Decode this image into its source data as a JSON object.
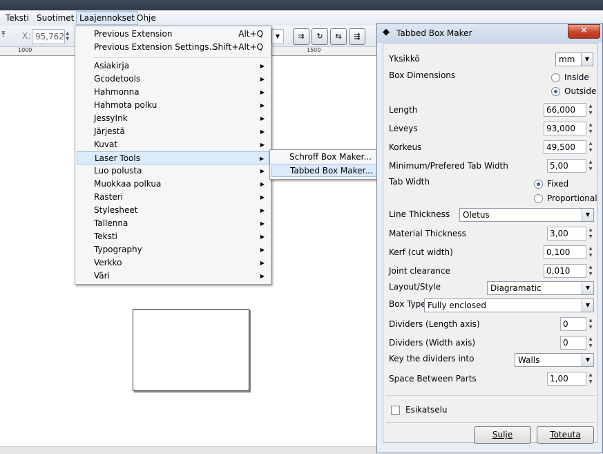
{
  "menubar": {
    "items": [
      "Teksti",
      "Suotimet",
      "Laajennokset",
      "Ohje"
    ],
    "open_item": "Laajennokset"
  },
  "toolbar": {
    "x_label": "X:",
    "x_value": "95,762"
  },
  "ruler": {
    "ticks": [
      "1000",
      "1500"
    ]
  },
  "extensions_menu": {
    "top_items": [
      {
        "label": "Previous Extension",
        "shortcut": "Alt+Q"
      },
      {
        "label": "Previous Extension Settings...",
        "shortcut": "Shift+Alt+Q"
      }
    ],
    "submenus": [
      "Asiakirja",
      "Gcodetools",
      "Hahmonna",
      "Hahmota polku",
      "JessyInk",
      "Järjestä",
      "Kuvat",
      "Laser Tools",
      "Luo polusta",
      "Muokkaa polkua",
      "Rasteri",
      "Stylesheet",
      "Tallenna",
      "Teksti",
      "Typography",
      "Verkko",
      "Väri"
    ],
    "highlighted": "Laser Tools"
  },
  "laser_tools_menu": {
    "items": [
      "Schroff Box Maker...",
      "Tabbed Box Maker..."
    ],
    "highlighted": "Tabbed Box Maker..."
  },
  "dialog": {
    "title": "Tabbed Box Maker",
    "close_symbol": "✕",
    "unit": {
      "label": "Yksikkö",
      "value": "mm"
    },
    "box_dimensions": {
      "label": "Box Dimensions",
      "options": [
        "Inside",
        "Outside"
      ],
      "selected": "Outside"
    },
    "length": {
      "label": "Length",
      "value": "66,000"
    },
    "width": {
      "label": "Leveys",
      "value": "93,000"
    },
    "height": {
      "label": "Korkeus",
      "value": "49,500"
    },
    "tab_width_min": {
      "label": "Minimum/Prefered Tab Width",
      "value": "5,00"
    },
    "tab_width": {
      "label": "Tab Width",
      "options": [
        "Fixed",
        "Proportional"
      ],
      "selected": "Fixed"
    },
    "line_thickness": {
      "label": "Line Thickness",
      "value": "Oletus"
    },
    "material_thickness": {
      "label": "Material Thickness",
      "value": "3,00"
    },
    "kerf": {
      "label": "Kerf (cut width)",
      "value": "0,100"
    },
    "joint_clearance": {
      "label": "Joint clearance",
      "value": "0,010"
    },
    "layout_style": {
      "label": "Layout/Style",
      "value": "Diagramatic"
    },
    "box_type": {
      "label": "Box Type",
      "value": "Fully enclosed"
    },
    "dividers_length": {
      "label": "Dividers (Length axis)",
      "value": "0"
    },
    "dividers_width": {
      "label": "Dividers (Width axis)",
      "value": "0"
    },
    "key_dividers": {
      "label": "Key the dividers into",
      "value": "Walls"
    },
    "space_between": {
      "label": "Space Between Parts",
      "value": "1,00"
    },
    "preview": {
      "label": "Esikatselu",
      "checked": false
    },
    "buttons": {
      "close": "Sulje",
      "apply": "Toteuta"
    }
  }
}
